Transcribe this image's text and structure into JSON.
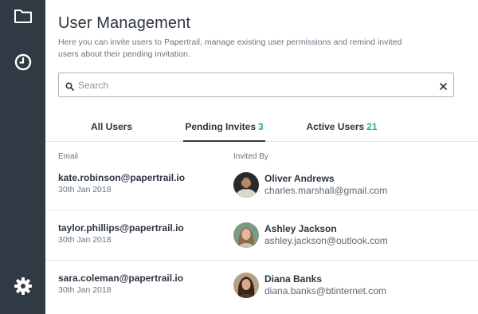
{
  "sidebar": {
    "icons": [
      "folder-icon",
      "clock-icon",
      "gear-icon"
    ],
    "icon_color": "#ffffff",
    "background": "#313a44"
  },
  "header": {
    "title": "User Management",
    "subtitle": "Here you can invite users to Papertrail, manage existing user permissions and remind invited users about their pending invitation."
  },
  "search": {
    "placeholder": "Search",
    "value": ""
  },
  "tabs": [
    {
      "label": "All Users",
      "count": ""
    },
    {
      "label": "Pending Invites",
      "count": "3",
      "selected": true
    },
    {
      "label": "Active Users",
      "count": "21"
    }
  ],
  "accent_count_color": "#26b36f",
  "columns": {
    "email": "Email",
    "invited_by": "Invited By"
  },
  "rows": [
    {
      "email": "kate.robinson@papertrail.io",
      "date": "30th Jan 2018",
      "inviter_name": "Oliver Andrews",
      "inviter_email": "charles.marshall@gmail.com"
    },
    {
      "email": "taylor.phillips@papertrail.io",
      "date": "30th Jan 2018",
      "inviter_name": "Ashley Jackson",
      "inviter_email": "ashley.jackson@outlook.com"
    },
    {
      "email": "sara.coleman@papertrail.io",
      "date": "30th Jan 2018",
      "inviter_name": "Diana Banks",
      "inviter_email": "diana.banks@btinternet.com"
    }
  ]
}
